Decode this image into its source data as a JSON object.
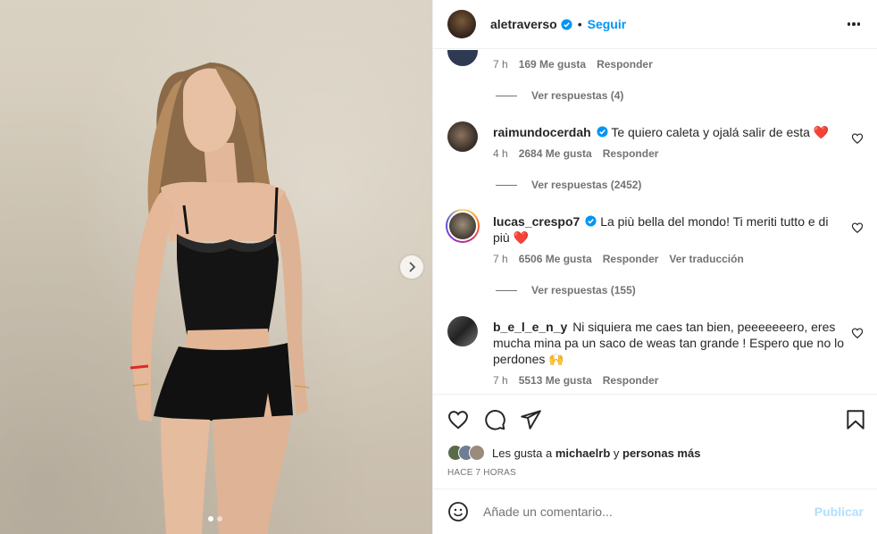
{
  "post": {
    "author": "aletraverso",
    "follow_label": "Seguir",
    "separator": "•",
    "image_count": 2,
    "image_active_index": 0
  },
  "comments": {
    "top_partial": {
      "time": "7 h",
      "likes": "169 Me gusta",
      "reply_label": "Responder",
      "view_replies": "Ver respuestas (4)"
    },
    "items": [
      {
        "username": "raimundocerdah",
        "text": "Te quiero caleta y ojalá salir de esta",
        "emoji": "❤️",
        "time": "4 h",
        "likes": "2684 Me gusta",
        "reply_label": "Responder",
        "view_replies": "Ver respuestas (2452)"
      },
      {
        "username": "lucas_crespo7",
        "text": "La più bella del mondo! Ti meriti tutto e di più",
        "emoji": "❤️",
        "time": "7 h",
        "likes": "6506 Me gusta",
        "reply_label": "Responder",
        "translate_label": "Ver traducción",
        "view_replies": "Ver respuestas (155)"
      },
      {
        "username": "b_e_l_e_n_y",
        "text": "Ni siquiera me caes tan bien, peeeeeeero, eres mucha mina pa un saco de weas tan grande ! Espero que no lo perdones",
        "emoji": "🙌",
        "time": "7 h",
        "likes": "5513 Me gusta",
        "reply_label": "Responder"
      }
    ]
  },
  "likes_summary": {
    "prefix": "Les gusta a",
    "user": "michaelrb",
    "joiner": "y",
    "others": "personas más"
  },
  "time_ago": "HACE 7 HORAS",
  "add_comment": {
    "placeholder": "Añade un comentario...",
    "publish_label": "Publicar"
  },
  "colors": {
    "accent": "#0095f6",
    "verified": "#0095f6",
    "publish_disabled": "#b2dffc",
    "heart": "#ed2e3a"
  }
}
